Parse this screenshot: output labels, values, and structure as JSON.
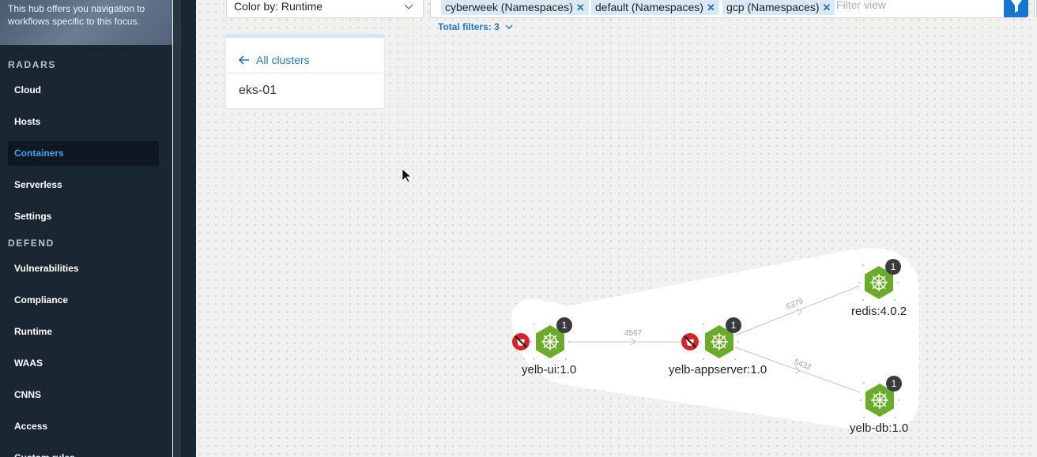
{
  "sidebar": {
    "hub_text_line1": "This hub offers you navigation to",
    "hub_text_line2": "workflows specific to this focus.",
    "sections": [
      {
        "title": "RADARS",
        "items": [
          "Cloud",
          "Hosts",
          "Containers",
          "Serverless",
          "Settings"
        ]
      },
      {
        "title": "DEFEND",
        "items": [
          "Vulnerabilities",
          "Compliance",
          "Runtime",
          "WAAS",
          "CNNS",
          "Access",
          "Custom rules"
        ]
      }
    ],
    "active_item": "Containers"
  },
  "toolbar": {
    "color_by": "Color by: Runtime",
    "filters": [
      "cyberweek (Namespaces)",
      "default (Namespaces)",
      "gcp (Namespaces)"
    ],
    "filter_placeholder": "Filter view",
    "total_filters": "Total filters: 3"
  },
  "cluster_card": {
    "back_label": "All clusters",
    "cluster_name": "eks-01"
  },
  "graph": {
    "nodes": [
      {
        "label": "yelb-ui:1.0",
        "count": "1",
        "runtime_alert": true
      },
      {
        "label": "yelb-appserver:1.0",
        "count": "1",
        "runtime_alert": true
      },
      {
        "label": "redis:4.0.2",
        "count": "1",
        "runtime_alert": false
      },
      {
        "label": "yelb-db:1.0",
        "count": "1",
        "runtime_alert": false
      }
    ],
    "edges": [
      {
        "from": "yelb-ui:1.0",
        "to": "yelb-appserver:1.0",
        "port": "4567"
      },
      {
        "from": "yelb-appserver:1.0",
        "to": "redis:4.0.2",
        "port": "6379"
      },
      {
        "from": "yelb-appserver:1.0",
        "to": "yelb-db:1.0",
        "port": "5432"
      }
    ]
  },
  "colors": {
    "node_green": "#6aab2a",
    "accent_blue": "#1876d2",
    "alert_red": "#d8232a",
    "sidebar_bg": "#1b2633"
  }
}
